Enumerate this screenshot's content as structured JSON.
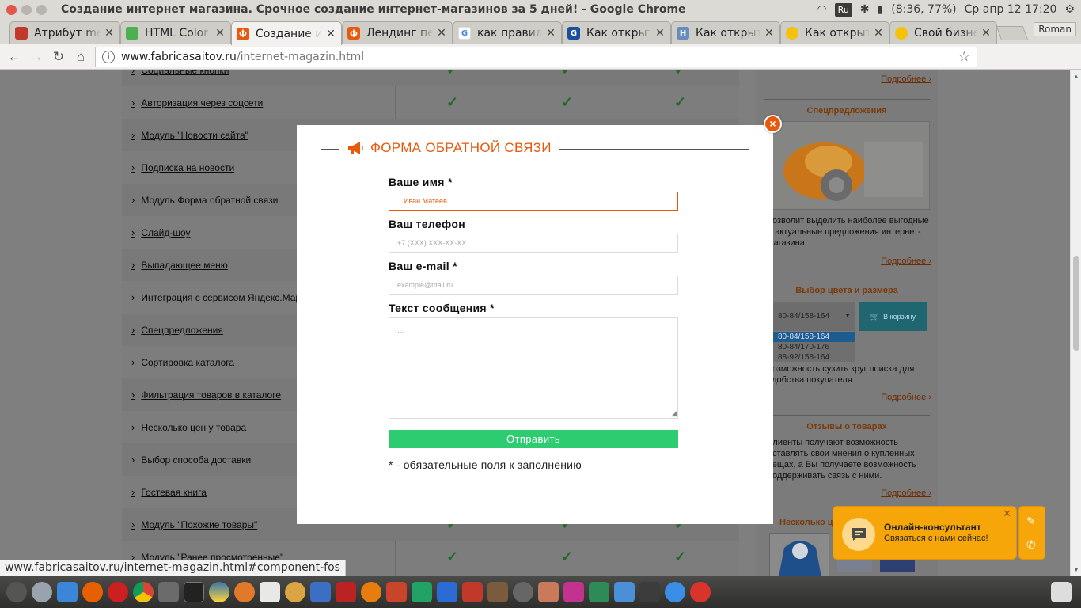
{
  "window": {
    "title": "Создание интернет магазина. Срочное создание интернет-магазинов за 5 дней! - Google Chrome"
  },
  "tray": {
    "keyboard_layout": "Ru",
    "battery": "(8:36, 77%)",
    "clock": "Ср апр 12 17:20"
  },
  "tabs": [
    {
      "label": "Атрибут method",
      "icon": "red-square-icon",
      "color": "#c0392b"
    },
    {
      "label": "HTML Color Codes",
      "icon": "green-puzzle-icon",
      "color": "#4caf50"
    },
    {
      "label": "Создание интернет",
      "icon": "orange-phi-icon",
      "color": "#e8590c",
      "active": true
    },
    {
      "label": "Лендинг пейдж",
      "icon": "orange-phi-icon",
      "color": "#e8590c"
    },
    {
      "label": "как правильно",
      "icon": "google-icon",
      "color": "#4285f4"
    },
    {
      "label": "Как открыть",
      "icon": "gu-icon",
      "color": "#1a4f9c"
    },
    {
      "label": "Как открыть",
      "icon": "h-icon",
      "color": "#6a8cbc"
    },
    {
      "label": "Как открыть",
      "icon": "yellow-circle-icon",
      "color": "#f4c20d"
    },
    {
      "label": "Свой бизнес",
      "icon": "yellow-circle-icon",
      "color": "#f4c20d"
    }
  ],
  "profile": "Roman",
  "address": {
    "host": "www.fabricasaitov.ru",
    "path": "/internet-magazin.html"
  },
  "left_list": [
    {
      "label": "Социальные кнопки",
      "link": true
    },
    {
      "label": "Авторизация через соцсети",
      "link": true
    },
    {
      "label": "Модуль \"Новости сайта\"",
      "link": true
    },
    {
      "label": "Подписка на новости",
      "link": true
    },
    {
      "label": "Модуль Форма обратной связи",
      "link": false
    },
    {
      "label": "Слайд-шоу",
      "link": true
    },
    {
      "label": "Выпадающее меню",
      "link": true
    },
    {
      "label": "Интеграция с сервисом Яндекс.Маркет",
      "link": false
    },
    {
      "label": "Спецпредложения",
      "link": true
    },
    {
      "label": "Сортировка каталога",
      "link": true
    },
    {
      "label": "Фильтрация товаров в каталоге",
      "link": true
    },
    {
      "label": "Несколько цен у товара",
      "link": false
    },
    {
      "label": "Выбор способа доставки",
      "link": false
    },
    {
      "label": "Гостевая книга",
      "link": true
    },
    {
      "label": "Модуль \"Похожие товары\"",
      "link": true
    },
    {
      "label": "Модуль \"Ранее просмотренные\"",
      "link": true
    }
  ],
  "right_sidebar": {
    "more": "Подробнее ›",
    "special_title": "Спецпредложения",
    "special_text": "позволит выделить наиболее выгодные и актуальные предложения интернет-магазина.",
    "color_title": "Выбор цвета и размера",
    "color_select": "80-84/158-164",
    "color_options": [
      "80-84/158-164",
      "80-84/170-176",
      "88-92/158-164"
    ],
    "cart_button": "В корзину",
    "color_text": "возможность сузить круг поиска для удобства покупателя.",
    "reviews_title": "Отзывы о товарах",
    "reviews_text": "Клиенты получают возможность оставлять свои мнения о купленных вещах, а Вы получаете возможность поддерживать связь с ними.",
    "prices_title": "Несколько цен"
  },
  "modal": {
    "title": "ФОРМА ОБРАТНОЙ СВЯЗИ",
    "name_label": "Ваше имя *",
    "name_value": "Иван Матеев",
    "phone_label": "Ваш телефон",
    "phone_placeholder": "+7 (XXX) XXX-XX-XX",
    "email_label": "Ваш e-mail *",
    "email_placeholder": "example@mail.ru",
    "message_label": "Текст сообщения *",
    "message_placeholder": "...",
    "submit": "Отправить",
    "required_note": "* - обязательные поля к заполнению",
    "accent_color": "#e8590c",
    "submit_color": "#2ecc71"
  },
  "chat": {
    "title": "Онлайн-консультант",
    "subtitle": "Связаться с нами сейчас!"
  },
  "status_url": "www.fabricasaitov.ru/internet-magazin.html#component-fos"
}
